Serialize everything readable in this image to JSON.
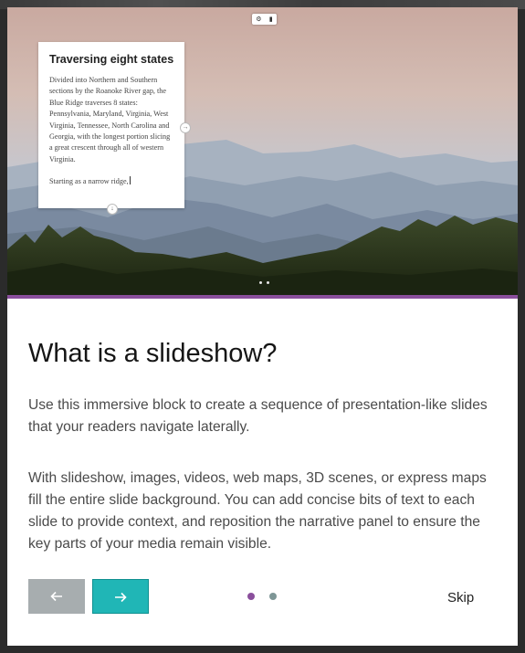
{
  "preview": {
    "panel_title": "Traversing eight states",
    "panel_body": "Divided into Northern and Southern sections by the Roanoke River gap, the Blue Ridge traverses 8 states: Pennsylvania, Maryland, Virginia, West Virginia, Tennessee, North Carolina and Georgia, with the longest portion slicing a great crescent through all of western Virginia.",
    "panel_body_2": "Starting as a narrow ridge,",
    "toolbar_icons": [
      "gear-icon",
      "trash-icon"
    ],
    "slide_count": 2
  },
  "intro": {
    "heading": "What is a slideshow?",
    "paragraph_1": "Use this immersive block to create a sequence of presentation-like slides that your readers navigate laterally.",
    "paragraph_2": "With slideshow, images, videos, web maps, 3D scenes, or express maps fill the entire slide background. You can add concise bits of text to each slide to provide context, and reposition the narrative panel to ensure the key parts of your media remain visible."
  },
  "nav": {
    "prev_icon": "arrow-left-icon",
    "next_icon": "arrow-right-icon",
    "skip_label": "Skip",
    "steps": [
      {
        "active": true
      },
      {
        "active": false
      }
    ]
  },
  "colors": {
    "accent": "#8a4f9c",
    "next_button": "#20b6b6",
    "prev_button": "#a7adaf",
    "step_active": "#8a4f9c",
    "step_inactive": "#7e9696"
  }
}
